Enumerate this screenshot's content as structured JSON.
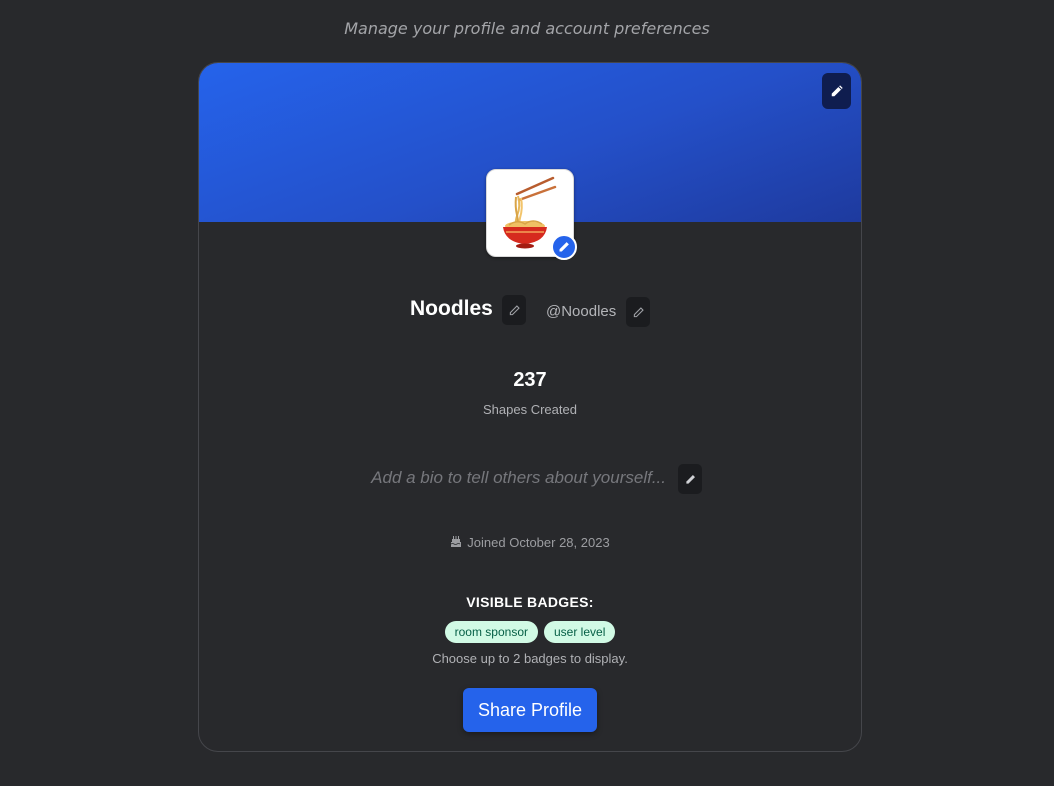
{
  "page": {
    "subtitle": "Manage your profile and account preferences"
  },
  "profile": {
    "display_name": "Noodles",
    "username": "@Noodles",
    "avatar_icon": "noodle-bowl-icon",
    "banner_colors": [
      "#2563eb",
      "#1e3a9e"
    ]
  },
  "stats": {
    "value": "237",
    "label": "Shapes Created"
  },
  "bio": {
    "placeholder": "Add a bio to tell others about yourself..."
  },
  "joined": {
    "icon": "cake-icon",
    "text": "Joined October 28, 2023"
  },
  "badges": {
    "title": "VISIBLE BADGES:",
    "items": [
      {
        "label": "room sponsor"
      },
      {
        "label": "user level"
      }
    ],
    "hint": "Choose up to 2 badges to display."
  },
  "actions": {
    "share_label": "Share Profile",
    "accent_color": "#2563eb"
  }
}
